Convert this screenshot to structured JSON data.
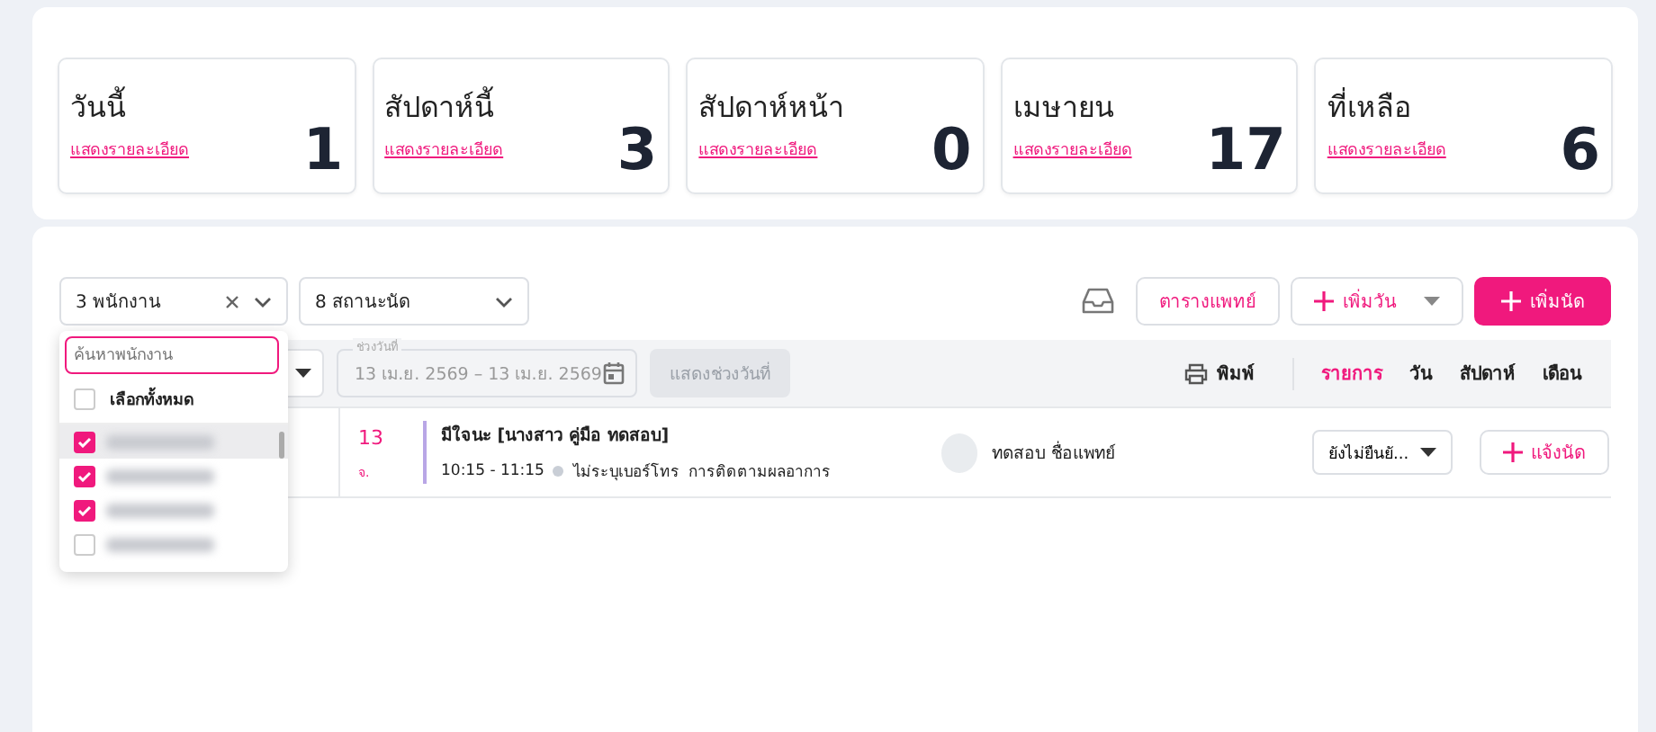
{
  "stats": [
    {
      "title": "วันนี้",
      "link": "แสดงรายละเอียด",
      "count": "1"
    },
    {
      "title": "สัปดาห์นี้",
      "link": "แสดงรายละเอียด",
      "count": "3"
    },
    {
      "title": "สัปดาห์หน้า",
      "link": "แสดงรายละเอียด",
      "count": "0"
    },
    {
      "title": "เมษายน",
      "link": "แสดงรายละเอียด",
      "count": "17"
    },
    {
      "title": "ที่เหลือ",
      "link": "แสดงรายละเอียด",
      "count": "6"
    }
  ],
  "filters": {
    "staff": "3 พนักงาน",
    "status": "8 สถานะนัด"
  },
  "actions": {
    "doctor_schedule": "ตารางแพทย์",
    "add_day": "เพิ่มวัน",
    "add_appointment": "เพิ่มนัด"
  },
  "date_range": {
    "label": "ช่วงวันที่",
    "value": "13 เม.ย. 2569 – 13 เม.ย. 2569"
  },
  "show_range_button": {
    "label": "แสดงช่วงวันที่",
    "disabled": true
  },
  "print": "พิมพ์",
  "views": [
    {
      "label": "รายการ",
      "selected": true
    },
    {
      "label": "วัน",
      "selected": false
    },
    {
      "label": "สัปดาห์",
      "selected": false
    },
    {
      "label": "เดือน",
      "selected": false
    }
  ],
  "appointments": [
    {
      "day": "13",
      "weekday": "จ.",
      "title": "มีใจนะ [นางสาว คู่มือ ทดสอบ]",
      "time": "10:15 - 11:15",
      "phone": "ไม่ระบุเบอร์โทร",
      "purpose": "การติดตามผลอาการ",
      "doctor": "ทดสอบ ชื่อแพทย์",
      "status": "ยังไม่ยืนยั...",
      "notify": "แจ้งนัด"
    }
  ],
  "staff_dropdown": {
    "search_placeholder": "ค้นหาพนักงาน",
    "select_all": {
      "label": "เลือกทั้งหมด",
      "checked": false
    },
    "staff": [
      {
        "checked": true,
        "hovered": true
      },
      {
        "checked": true,
        "hovered": false
      },
      {
        "checked": true,
        "hovered": false
      },
      {
        "checked": false,
        "hovered": false
      }
    ]
  }
}
